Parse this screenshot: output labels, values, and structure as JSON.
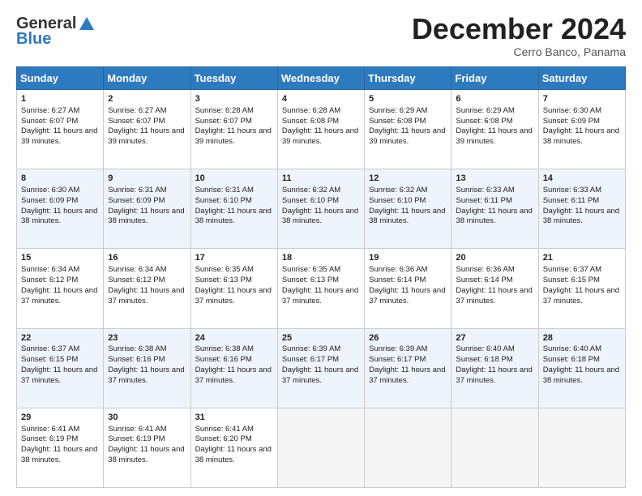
{
  "header": {
    "logo_general": "General",
    "logo_blue": "Blue",
    "month_title": "December 2024",
    "location": "Cerro Banco, Panama"
  },
  "days_of_week": [
    "Sunday",
    "Monday",
    "Tuesday",
    "Wednesday",
    "Thursday",
    "Friday",
    "Saturday"
  ],
  "weeks": [
    [
      {
        "day": "1",
        "sunrise": "6:27 AM",
        "sunset": "6:07 PM",
        "daylight": "11 hours and 39 minutes."
      },
      {
        "day": "2",
        "sunrise": "6:27 AM",
        "sunset": "6:07 PM",
        "daylight": "11 hours and 39 minutes."
      },
      {
        "day": "3",
        "sunrise": "6:28 AM",
        "sunset": "6:07 PM",
        "daylight": "11 hours and 39 minutes."
      },
      {
        "day": "4",
        "sunrise": "6:28 AM",
        "sunset": "6:08 PM",
        "daylight": "11 hours and 39 minutes."
      },
      {
        "day": "5",
        "sunrise": "6:29 AM",
        "sunset": "6:08 PM",
        "daylight": "11 hours and 39 minutes."
      },
      {
        "day": "6",
        "sunrise": "6:29 AM",
        "sunset": "6:08 PM",
        "daylight": "11 hours and 39 minutes."
      },
      {
        "day": "7",
        "sunrise": "6:30 AM",
        "sunset": "6:09 PM",
        "daylight": "11 hours and 38 minutes."
      }
    ],
    [
      {
        "day": "8",
        "sunrise": "6:30 AM",
        "sunset": "6:09 PM",
        "daylight": "11 hours and 38 minutes."
      },
      {
        "day": "9",
        "sunrise": "6:31 AM",
        "sunset": "6:09 PM",
        "daylight": "11 hours and 38 minutes."
      },
      {
        "day": "10",
        "sunrise": "6:31 AM",
        "sunset": "6:10 PM",
        "daylight": "11 hours and 38 minutes."
      },
      {
        "day": "11",
        "sunrise": "6:32 AM",
        "sunset": "6:10 PM",
        "daylight": "11 hours and 38 minutes."
      },
      {
        "day": "12",
        "sunrise": "6:32 AM",
        "sunset": "6:10 PM",
        "daylight": "11 hours and 38 minutes."
      },
      {
        "day": "13",
        "sunrise": "6:33 AM",
        "sunset": "6:11 PM",
        "daylight": "11 hours and 38 minutes."
      },
      {
        "day": "14",
        "sunrise": "6:33 AM",
        "sunset": "6:11 PM",
        "daylight": "11 hours and 38 minutes."
      }
    ],
    [
      {
        "day": "15",
        "sunrise": "6:34 AM",
        "sunset": "6:12 PM",
        "daylight": "11 hours and 37 minutes."
      },
      {
        "day": "16",
        "sunrise": "6:34 AM",
        "sunset": "6:12 PM",
        "daylight": "11 hours and 37 minutes."
      },
      {
        "day": "17",
        "sunrise": "6:35 AM",
        "sunset": "6:13 PM",
        "daylight": "11 hours and 37 minutes."
      },
      {
        "day": "18",
        "sunrise": "6:35 AM",
        "sunset": "6:13 PM",
        "daylight": "11 hours and 37 minutes."
      },
      {
        "day": "19",
        "sunrise": "6:36 AM",
        "sunset": "6:14 PM",
        "daylight": "11 hours and 37 minutes."
      },
      {
        "day": "20",
        "sunrise": "6:36 AM",
        "sunset": "6:14 PM",
        "daylight": "11 hours and 37 minutes."
      },
      {
        "day": "21",
        "sunrise": "6:37 AM",
        "sunset": "6:15 PM",
        "daylight": "11 hours and 37 minutes."
      }
    ],
    [
      {
        "day": "22",
        "sunrise": "6:37 AM",
        "sunset": "6:15 PM",
        "daylight": "11 hours and 37 minutes."
      },
      {
        "day": "23",
        "sunrise": "6:38 AM",
        "sunset": "6:16 PM",
        "daylight": "11 hours and 37 minutes."
      },
      {
        "day": "24",
        "sunrise": "6:38 AM",
        "sunset": "6:16 PM",
        "daylight": "11 hours and 37 minutes."
      },
      {
        "day": "25",
        "sunrise": "6:39 AM",
        "sunset": "6:17 PM",
        "daylight": "11 hours and 37 minutes."
      },
      {
        "day": "26",
        "sunrise": "6:39 AM",
        "sunset": "6:17 PM",
        "daylight": "11 hours and 37 minutes."
      },
      {
        "day": "27",
        "sunrise": "6:40 AM",
        "sunset": "6:18 PM",
        "daylight": "11 hours and 37 minutes."
      },
      {
        "day": "28",
        "sunrise": "6:40 AM",
        "sunset": "6:18 PM",
        "daylight": "11 hours and 38 minutes."
      }
    ],
    [
      {
        "day": "29",
        "sunrise": "6:41 AM",
        "sunset": "6:19 PM",
        "daylight": "11 hours and 38 minutes."
      },
      {
        "day": "30",
        "sunrise": "6:41 AM",
        "sunset": "6:19 PM",
        "daylight": "11 hours and 38 minutes."
      },
      {
        "day": "31",
        "sunrise": "6:41 AM",
        "sunset": "6:20 PM",
        "daylight": "11 hours and 38 minutes."
      },
      null,
      null,
      null,
      null
    ]
  ]
}
